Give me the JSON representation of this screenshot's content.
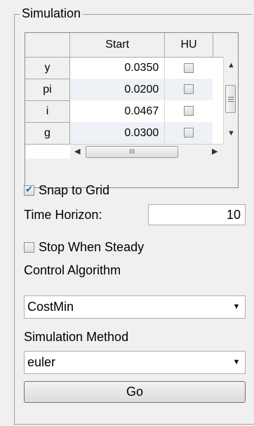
{
  "panel": {
    "title": "Simulation"
  },
  "table": {
    "headers": [
      "",
      "Start",
      "HU"
    ],
    "rows": [
      {
        "name": "y",
        "start": "0.0350",
        "hu": false
      },
      {
        "name": "pi",
        "start": "0.0200",
        "hu": false
      },
      {
        "name": "i",
        "start": "0.0467",
        "hu": false
      },
      {
        "name": "g",
        "start": "0.0300",
        "hu": false
      }
    ],
    "hscroll_grip": "III"
  },
  "snap_to_grid": {
    "label": "Snap to Grid",
    "checked": true
  },
  "time_horizon": {
    "label": "Time Horizon:",
    "value": "10"
  },
  "stop_when_steady": {
    "label": "Stop When Steady",
    "checked": false
  },
  "control_algorithm": {
    "label": "Control Algorithm",
    "selected": "CostMin"
  },
  "simulation_method": {
    "label": "Simulation Method",
    "selected": "euler"
  },
  "go_button": {
    "label": "Go"
  },
  "icons": {
    "scroll_up": "triangle-up-icon",
    "scroll_down": "triangle-down-icon",
    "scroll_left": "triangle-left-icon",
    "scroll_right": "triangle-right-icon",
    "dropdown": "chevron-down-icon"
  },
  "colors": {
    "panel_bg": "#f0f0f0",
    "checkmark": "#2b5aa8"
  }
}
